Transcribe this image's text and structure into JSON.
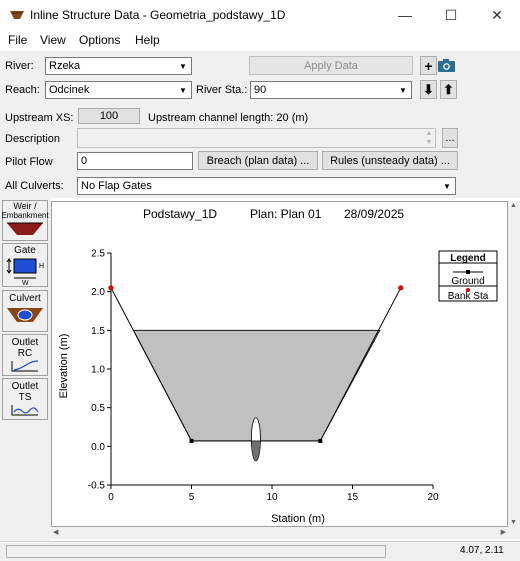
{
  "window": {
    "title": "Inline Structure Data - Geometria_podstawy_1D",
    "minimize_glyph": "—",
    "maximize_glyph": "☐",
    "close_glyph": "✕"
  },
  "menu": [
    "File",
    "View",
    "Options",
    "Help"
  ],
  "form": {
    "river_label": "River:",
    "river_value": "Rzeka",
    "apply_data_label": "Apply Data",
    "reach_label": "Reach:",
    "reach_value": "Odcinek",
    "river_sta_label": "River Sta.:",
    "river_sta_value": "90",
    "upstream_xs_label": "Upstream XS:",
    "upstream_xs_value": "100",
    "upstream_channel_length": "Upstream channel length: 20 (m)",
    "description_label": "Description",
    "description_value": "",
    "ellipsis": "...",
    "pilot_flow_label": "Pilot Flow",
    "pilot_flow_value": "0",
    "breach_button": "Breach (plan data) ...",
    "rules_button": "Rules (unsteady data) ...",
    "all_culverts_label": "All Culverts:",
    "all_culverts_value": "No Flap Gates"
  },
  "tools": {
    "weir_label_1": "Weir /",
    "weir_label_2": "Embankment",
    "gate_label": "Gate",
    "gate_h": "H",
    "gate_w": "W",
    "culvert_label": "Culvert",
    "outlet_rc_1": "Outlet",
    "outlet_rc_2": "RC",
    "outlet_ts_1": "Outlet",
    "outlet_ts_2": "TS"
  },
  "plot": {
    "header_name": "Podstawy_1D",
    "header_plan": "Plan: Plan 01",
    "header_date": "28/09/2025",
    "legend_title": "Legend",
    "legend_ground": "Ground",
    "legend_bank": "Bank Sta",
    "colors": {
      "fill": "#c0c0c0",
      "bank": "#e00000",
      "line": "#000000"
    }
  },
  "status": {
    "coords": "4.07, 2.11"
  },
  "chart_data": {
    "type": "line",
    "xlabel": "Station (m)",
    "ylabel": "Elevation (m)",
    "xlim": [
      0,
      20
    ],
    "ylim": [
      -0.5,
      2.5
    ],
    "xticks": [
      0,
      5,
      10,
      15,
      20
    ],
    "yticks": [
      -0.5,
      0.0,
      0.5,
      1.0,
      1.5,
      2.0,
      2.5
    ],
    "series": [
      {
        "name": "Ground",
        "x": [
          0,
          5,
          13,
          18
        ],
        "y": [
          2.05,
          0.07,
          0.07,
          2.05
        ]
      },
      {
        "name": "Bank Sta",
        "x": [
          0,
          18
        ],
        "y": [
          2.05,
          2.05
        ]
      }
    ],
    "structure_fill": {
      "top_elevation": 1.5,
      "x_left": 1.4,
      "x_right": 16.7
    },
    "culvert_ellipse": {
      "x": 9,
      "y_bottom": -0.15,
      "y_top": 0.37
    },
    "legend_position": "top-right"
  }
}
